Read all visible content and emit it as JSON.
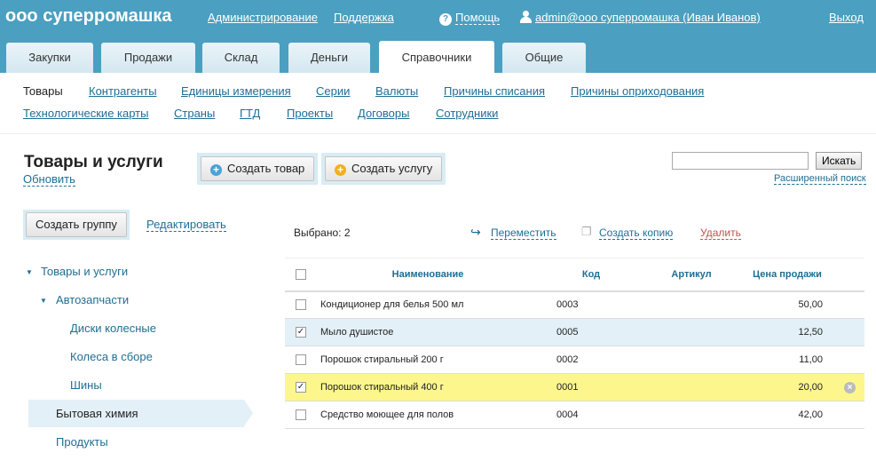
{
  "header": {
    "logo": "ооо суперромашка",
    "admin": "Администрирование",
    "support": "Поддержка",
    "help": "Помощь",
    "user": "admin@ооо суперромашка (Иван Иванов)",
    "logout": "Выход"
  },
  "tabs": [
    "Закупки",
    "Продажи",
    "Склад",
    "Деньги",
    "Справочники",
    "Общие"
  ],
  "active_tab": "Справочники",
  "subnav": {
    "row1": [
      "Товары",
      "Контрагенты",
      "Единицы измерения",
      "Серии",
      "Валюты",
      "Причины списания",
      "Причины оприходования"
    ],
    "row2": [
      "Технологические карты",
      "Страны",
      "ГТД",
      "Проекты",
      "Договоры",
      "Сотрудники"
    ]
  },
  "page": {
    "title": "Товары и услуги",
    "refresh": "Обновить",
    "create_product": "Создать товар",
    "create_service": "Создать услугу",
    "search_value": "",
    "search_button": "Искать",
    "advanced_search": "Расширенный поиск"
  },
  "sidebar": {
    "create_group": "Создать группу",
    "edit": "Редактировать",
    "tree": [
      "Товары и услуги",
      "Автозапчасти",
      "Диски колесные",
      "Колеса в сборе",
      "Шины",
      "Бытовая химия",
      "Продукты"
    ]
  },
  "toolbar": {
    "selected": "Выбрано: 2",
    "move": "Переместить",
    "copy": "Создать копию",
    "delete": "Удалить"
  },
  "table": {
    "headers": [
      "Наименование",
      "Код",
      "Артикул",
      "Цена продажи"
    ],
    "rows": [
      {
        "name": "Кондиционер для белья 500 мл",
        "code": "0003",
        "article": "",
        "price": "50,00",
        "checked": false
      },
      {
        "name": "Мыло душистое",
        "code": "0005",
        "article": "",
        "price": "12,50",
        "checked": true
      },
      {
        "name": "Порошок стиральный 200 г",
        "code": "0002",
        "article": "",
        "price": "11,00",
        "checked": false
      },
      {
        "name": "Порошок стиральный 400 г",
        "code": "0001",
        "article": "",
        "price": "20,00",
        "checked": true
      },
      {
        "name": "Средство моющее для полов",
        "code": "0004",
        "article": "",
        "price": "42,00",
        "checked": false
      }
    ]
  },
  "colors": {
    "header": "#4b9fc1",
    "link": "#1f6e94",
    "highlight": "#fdf68c",
    "selected": "#e3f0f7",
    "delete": "#c0504d"
  }
}
